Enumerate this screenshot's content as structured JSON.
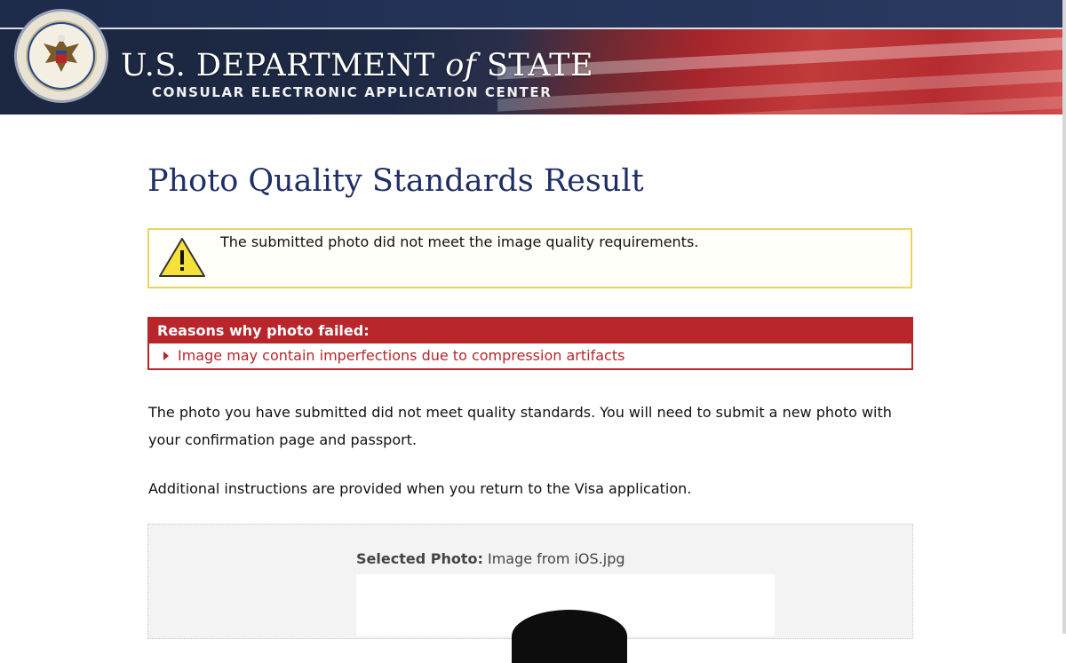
{
  "header": {
    "seal_icon": "us-department-of-state-seal",
    "department_prefix": "U.S. D",
    "department_name": "U.S. DEPARTMENT of STATE",
    "department_main": "U.S. DEPARTMENT",
    "department_of": "of",
    "department_state": "STATE",
    "subtitle": "CONSULAR ELECTRONIC APPLICATION CENTER"
  },
  "page": {
    "title": "Photo Quality Standards Result"
  },
  "warning": {
    "icon": "warning-triangle-icon",
    "message": "The submitted photo did not meet the image quality requirements."
  },
  "reasons": {
    "heading": "Reasons why photo failed:",
    "items": [
      "Image may contain imperfections due to compression artifacts"
    ]
  },
  "body": {
    "paragraph_1": "The photo you have submitted did not meet quality standards. You will need to submit a new photo with your confirmation page and passport.",
    "paragraph_2": "Additional instructions are provided when you return to the Visa application."
  },
  "photo": {
    "label": "Selected Photo:",
    "filename": "Image from iOS.jpg"
  },
  "colors": {
    "title": "#1f2f66",
    "warning_border": "#e8d560",
    "reasons_red": "#b8262b"
  }
}
